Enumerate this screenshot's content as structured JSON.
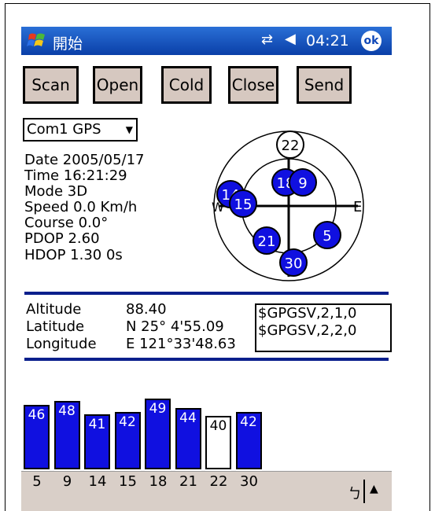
{
  "taskbar": {
    "start_label": "開始",
    "clock": "04:21",
    "ok_label": "ok",
    "connectivity_glyph": "⇄",
    "volume_glyph": "◀"
  },
  "toolbar": {
    "scan": "Scan",
    "open": "Open",
    "cold": "Cold",
    "close": "Close",
    "send": "Send"
  },
  "port_select": {
    "value": "Com1 GPS"
  },
  "status": {
    "date": "Date  2005/05/17",
    "time": "Time  16:21:29",
    "mode": "Mode  3D",
    "speed": "Speed 0.0 Km/h",
    "course": "Course  0.0°",
    "pdop": "PDOP  2.60",
    "hdop": "HDOP  1.30    0s"
  },
  "skyplot": {
    "east_label": "E",
    "west_label": "W",
    "satellites": [
      {
        "prn": "22",
        "active": false
      },
      {
        "prn": "18",
        "active": true
      },
      {
        "prn": "9",
        "active": true
      },
      {
        "prn": "14",
        "active": true
      },
      {
        "prn": "15",
        "active": true
      },
      {
        "prn": "21",
        "active": true
      },
      {
        "prn": "5",
        "active": true
      },
      {
        "prn": "30",
        "active": true
      }
    ]
  },
  "position": {
    "altitude_label": "Altitude",
    "altitude_value": "88.40",
    "latitude_label": "Latitude",
    "latitude_value": "N  25° 4'55.09",
    "longitude_label": "Longitude",
    "longitude_value": "E 121°33'48.63"
  },
  "nmea_lines": [
    "$GPGSV,2,1,0",
    "$GPGSV,2,2,0"
  ],
  "signal_bars": [
    {
      "prn": "5",
      "snr": "46",
      "active": true
    },
    {
      "prn": "9",
      "snr": "48",
      "active": true
    },
    {
      "prn": "14",
      "snr": "41",
      "active": true
    },
    {
      "prn": "15",
      "snr": "42",
      "active": true
    },
    {
      "prn": "18",
      "snr": "49",
      "active": true
    },
    {
      "prn": "21",
      "snr": "44",
      "active": true
    },
    {
      "prn": "22",
      "snr": "40",
      "active": false
    },
    {
      "prn": "30",
      "snr": "42",
      "active": true
    }
  ],
  "colors": {
    "taskbar": "#0a3fa8",
    "satellite_active": "#1010e0",
    "bar_active": "#1010e0",
    "rule": "#0a1f8c",
    "button_face": "#d6c8c0",
    "command_bar": "#d9cfc8"
  },
  "commandbar": {
    "keyboard_glyph": "ㄅ",
    "up_glyph": "▲"
  }
}
